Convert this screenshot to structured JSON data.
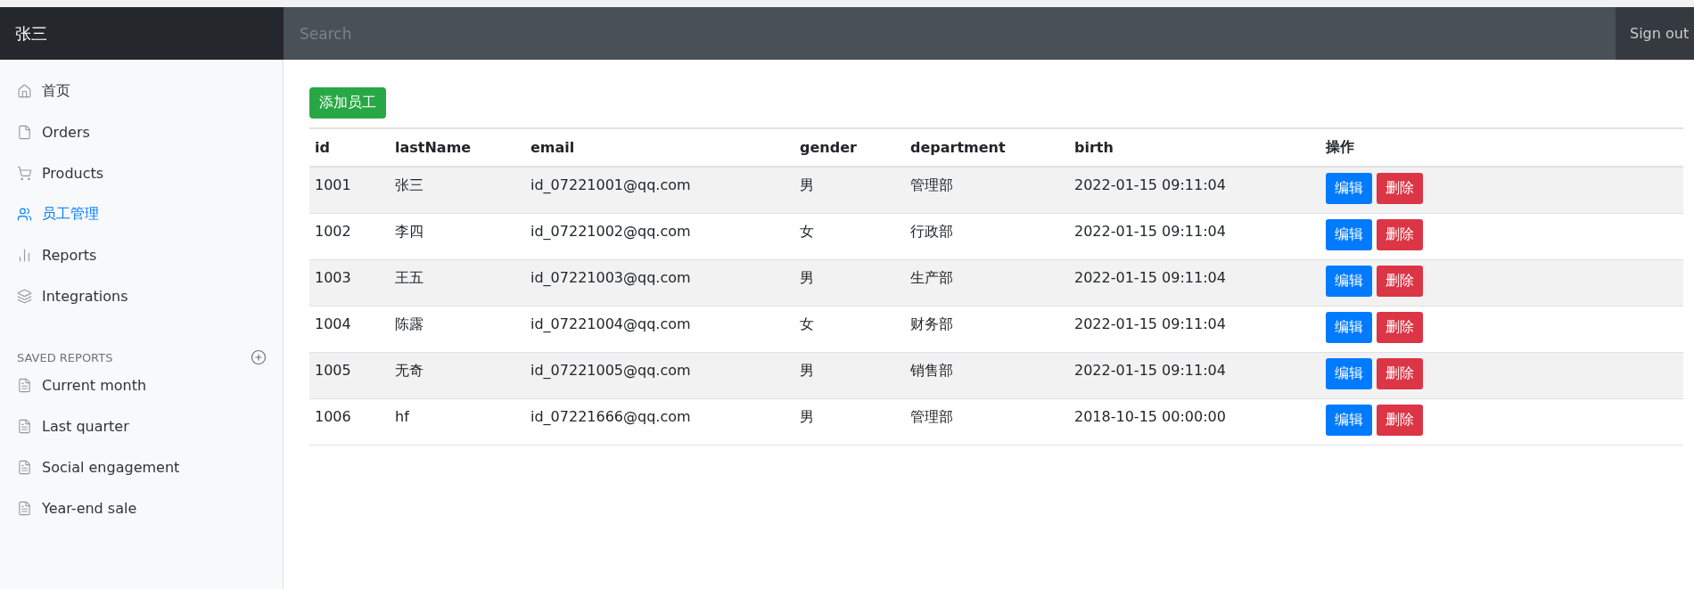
{
  "navbar": {
    "brand": "张三",
    "search": {
      "placeholder": "Search"
    },
    "sign_out": "Sign out"
  },
  "sidebar": {
    "items": [
      {
        "label": "首页",
        "selected": false
      },
      {
        "label": "Orders",
        "selected": false
      },
      {
        "label": "Products",
        "selected": false
      },
      {
        "label": "员工管理",
        "selected": true
      },
      {
        "label": "Reports",
        "selected": false
      },
      {
        "label": "Integrations",
        "selected": false
      }
    ],
    "saved_reports": {
      "heading": "SAVED REPORTS",
      "items": [
        "Current month",
        "Last quarter",
        "Social engagement",
        "Year-end sale"
      ]
    }
  },
  "add_button": "添加员工",
  "table": {
    "columns": [
      "id",
      "lastName",
      "email",
      "gender",
      "department",
      "birth",
      "操作"
    ],
    "rows": [
      {
        "cells": [
          "1001",
          "张三",
          "id_07221001@qq.com",
          "男",
          "管理部",
          "2022-01-15 09:11:04"
        ],
        "actions": [
          "编辑",
          "删除"
        ]
      },
      {
        "cells": [
          "1002",
          "李四",
          "id_07221002@qq.com",
          "女",
          "行政部",
          "2022-01-15 09:11:04"
        ],
        "actions": [
          "编辑",
          "删除"
        ]
      },
      {
        "cells": [
          "1003",
          "王五",
          "id_07221003@qq.com",
          "男",
          "生产部",
          "2022-01-15 09:11:04"
        ],
        "actions": [
          "编辑",
          "删除"
        ]
      },
      {
        "cells": [
          "1004",
          "陈露",
          "id_07221004@qq.com",
          "女",
          "财务部",
          "2022-01-15 09:11:04"
        ],
        "actions": [
          "编辑",
          "删除"
        ]
      },
      {
        "cells": [
          "1005",
          "无奇",
          "id_07221005@qq.com",
          "男",
          "销售部",
          "2022-01-15 09:11:04"
        ],
        "actions": [
          "编辑",
          "删除"
        ]
      },
      {
        "cells": [
          "1006",
          "hf",
          "id_07221666@qq.com",
          "男",
          "管理部",
          "2018-10-15 00:00:00"
        ],
        "actions": [
          "编辑",
          "删除"
        ]
      }
    ]
  }
}
